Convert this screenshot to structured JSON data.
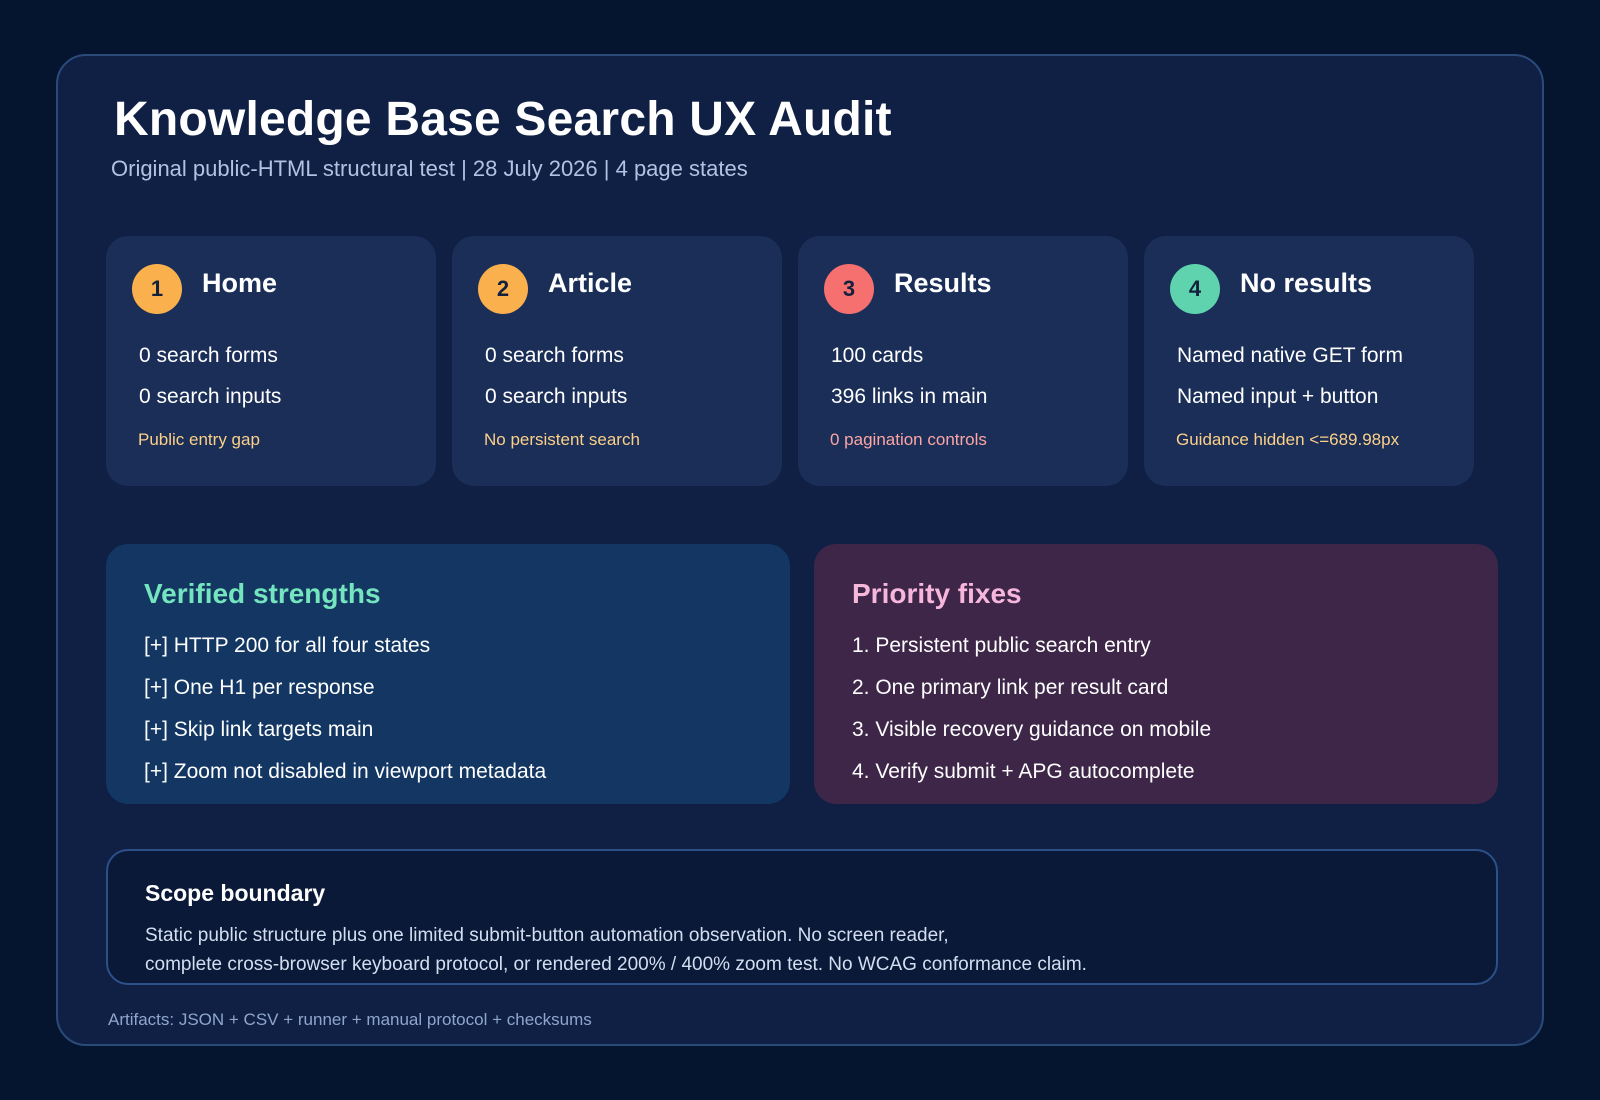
{
  "header": {
    "title": "Knowledge Base Search UX Audit",
    "subtitle": "Original public-HTML structural test | 28 July 2026 | 4 page states"
  },
  "states": [
    {
      "number": "1",
      "title": "Home",
      "metrics": [
        "0 search forms",
        "0 search inputs"
      ],
      "note": "Public entry gap",
      "badge_color": "#fbb04e",
      "note_color": "#fcd08a"
    },
    {
      "number": "2",
      "title": "Article",
      "metrics": [
        "0 search forms",
        "0 search inputs"
      ],
      "note": "No persistent search",
      "badge_color": "#fbb04e",
      "note_color": "#fcd08a"
    },
    {
      "number": "3",
      "title": "Results",
      "metrics": [
        "100 cards",
        "396 links in main"
      ],
      "note": "0 pagination controls",
      "badge_color": "#f6706f",
      "note_color": "#fca5a5"
    },
    {
      "number": "4",
      "title": "No results",
      "metrics": [
        "Named native GET form",
        "Named input + button"
      ],
      "note": "Guidance hidden <=689.98px",
      "badge_color": "#5fd3ad",
      "note_color": "#fcd08a"
    }
  ],
  "strengths": {
    "title": "Verified strengths",
    "title_color": "#75e5bf",
    "items": [
      "[+] HTTP 200 for all four states",
      "[+] One H1 per response",
      "[+] Skip link targets main",
      "[+] Zoom not disabled in viewport metadata"
    ]
  },
  "fixes": {
    "title": "Priority fixes",
    "title_color": "#f7b6dc",
    "items": [
      "1. Persistent public search entry",
      "2. One primary link per result card",
      "3. Visible recovery guidance on mobile",
      "4. Verify submit + APG autocomplete"
    ]
  },
  "scope": {
    "title": "Scope boundary",
    "lines": [
      "Static public structure plus one limited submit-button automation observation. No screen reader,",
      "complete cross-browser keyboard protocol, or rendered 200% / 400% zoom test. No WCAG conformance claim."
    ]
  },
  "footer": {
    "artifacts": "Artifacts: JSON + CSV + runner + manual protocol + checksums"
  },
  "colors": {
    "background": "#06152f",
    "panel": "#0f2044",
    "card": "#1a2e57",
    "badge_text": "#14213d"
  }
}
